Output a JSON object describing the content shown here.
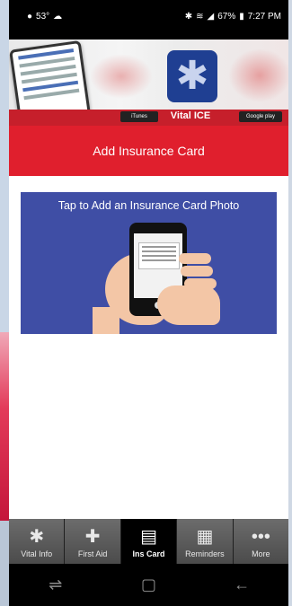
{
  "status_bar": {
    "temperature": "53°",
    "battery": "67%",
    "time": "7:27 PM"
  },
  "banner": {
    "brand": "Vital ICE",
    "app_store_label": "iTunes",
    "play_store_label": "Google play"
  },
  "page": {
    "title": "Add Insurance Card"
  },
  "photo_card": {
    "text": "Tap to Add an Insurance Card Photo"
  },
  "tabs": [
    {
      "label": "Vital Info",
      "icon": "asterisk-icon",
      "glyph": "✱"
    },
    {
      "label": "First Aid",
      "icon": "bandage-icon",
      "glyph": "✚"
    },
    {
      "label": "Ins Card",
      "icon": "card-icon",
      "glyph": "▤",
      "active": true
    },
    {
      "label": "Reminders",
      "icon": "calendar-icon",
      "glyph": "▦"
    },
    {
      "label": "More",
      "icon": "more-icon",
      "glyph": "•••"
    }
  ],
  "nav": {
    "recent_glyph": "⇌",
    "home_glyph": "▢",
    "back_glyph": "←"
  },
  "colors": {
    "title_bar": "#e01f2d",
    "photo_card_bg": "#3f4ea5",
    "tab_bar": "#4b4b4b",
    "tab_active": "#000000"
  }
}
